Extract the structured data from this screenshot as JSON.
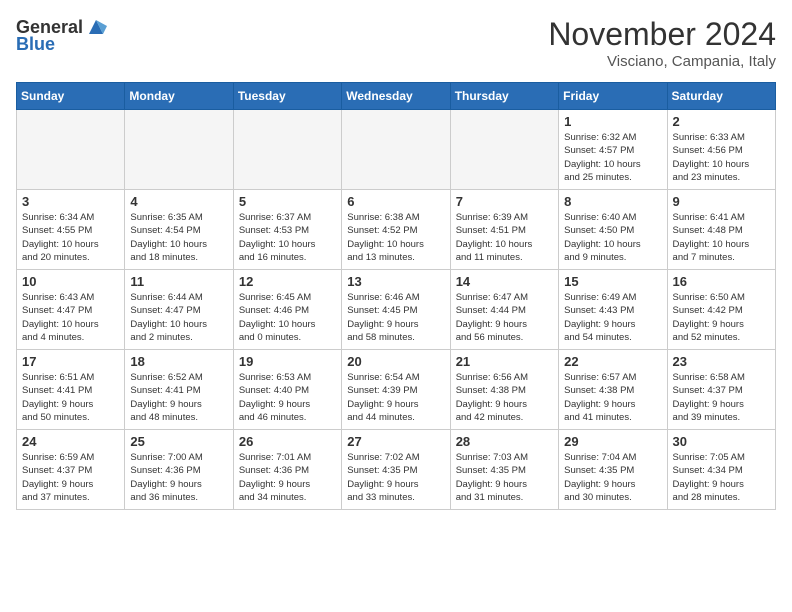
{
  "header": {
    "logo": {
      "general": "General",
      "blue": "Blue"
    },
    "title": "November 2024",
    "location": "Visciano, Campania, Italy"
  },
  "weekdays": [
    "Sunday",
    "Monday",
    "Tuesday",
    "Wednesday",
    "Thursday",
    "Friday",
    "Saturday"
  ],
  "weeks": [
    [
      {
        "day": "",
        "info": "",
        "empty": true
      },
      {
        "day": "",
        "info": "",
        "empty": true
      },
      {
        "day": "",
        "info": "",
        "empty": true
      },
      {
        "day": "",
        "info": "",
        "empty": true
      },
      {
        "day": "",
        "info": "",
        "empty": true
      },
      {
        "day": "1",
        "info": "Sunrise: 6:32 AM\nSunset: 4:57 PM\nDaylight: 10 hours\nand 25 minutes."
      },
      {
        "day": "2",
        "info": "Sunrise: 6:33 AM\nSunset: 4:56 PM\nDaylight: 10 hours\nand 23 minutes."
      }
    ],
    [
      {
        "day": "3",
        "info": "Sunrise: 6:34 AM\nSunset: 4:55 PM\nDaylight: 10 hours\nand 20 minutes."
      },
      {
        "day": "4",
        "info": "Sunrise: 6:35 AM\nSunset: 4:54 PM\nDaylight: 10 hours\nand 18 minutes."
      },
      {
        "day": "5",
        "info": "Sunrise: 6:37 AM\nSunset: 4:53 PM\nDaylight: 10 hours\nand 16 minutes."
      },
      {
        "day": "6",
        "info": "Sunrise: 6:38 AM\nSunset: 4:52 PM\nDaylight: 10 hours\nand 13 minutes."
      },
      {
        "day": "7",
        "info": "Sunrise: 6:39 AM\nSunset: 4:51 PM\nDaylight: 10 hours\nand 11 minutes."
      },
      {
        "day": "8",
        "info": "Sunrise: 6:40 AM\nSunset: 4:50 PM\nDaylight: 10 hours\nand 9 minutes."
      },
      {
        "day": "9",
        "info": "Sunrise: 6:41 AM\nSunset: 4:48 PM\nDaylight: 10 hours\nand 7 minutes."
      }
    ],
    [
      {
        "day": "10",
        "info": "Sunrise: 6:43 AM\nSunset: 4:47 PM\nDaylight: 10 hours\nand 4 minutes."
      },
      {
        "day": "11",
        "info": "Sunrise: 6:44 AM\nSunset: 4:47 PM\nDaylight: 10 hours\nand 2 minutes."
      },
      {
        "day": "12",
        "info": "Sunrise: 6:45 AM\nSunset: 4:46 PM\nDaylight: 10 hours\nand 0 minutes."
      },
      {
        "day": "13",
        "info": "Sunrise: 6:46 AM\nSunset: 4:45 PM\nDaylight: 9 hours\nand 58 minutes."
      },
      {
        "day": "14",
        "info": "Sunrise: 6:47 AM\nSunset: 4:44 PM\nDaylight: 9 hours\nand 56 minutes."
      },
      {
        "day": "15",
        "info": "Sunrise: 6:49 AM\nSunset: 4:43 PM\nDaylight: 9 hours\nand 54 minutes."
      },
      {
        "day": "16",
        "info": "Sunrise: 6:50 AM\nSunset: 4:42 PM\nDaylight: 9 hours\nand 52 minutes."
      }
    ],
    [
      {
        "day": "17",
        "info": "Sunrise: 6:51 AM\nSunset: 4:41 PM\nDaylight: 9 hours\nand 50 minutes."
      },
      {
        "day": "18",
        "info": "Sunrise: 6:52 AM\nSunset: 4:41 PM\nDaylight: 9 hours\nand 48 minutes."
      },
      {
        "day": "19",
        "info": "Sunrise: 6:53 AM\nSunset: 4:40 PM\nDaylight: 9 hours\nand 46 minutes."
      },
      {
        "day": "20",
        "info": "Sunrise: 6:54 AM\nSunset: 4:39 PM\nDaylight: 9 hours\nand 44 minutes."
      },
      {
        "day": "21",
        "info": "Sunrise: 6:56 AM\nSunset: 4:38 PM\nDaylight: 9 hours\nand 42 minutes."
      },
      {
        "day": "22",
        "info": "Sunrise: 6:57 AM\nSunset: 4:38 PM\nDaylight: 9 hours\nand 41 minutes."
      },
      {
        "day": "23",
        "info": "Sunrise: 6:58 AM\nSunset: 4:37 PM\nDaylight: 9 hours\nand 39 minutes."
      }
    ],
    [
      {
        "day": "24",
        "info": "Sunrise: 6:59 AM\nSunset: 4:37 PM\nDaylight: 9 hours\nand 37 minutes."
      },
      {
        "day": "25",
        "info": "Sunrise: 7:00 AM\nSunset: 4:36 PM\nDaylight: 9 hours\nand 36 minutes."
      },
      {
        "day": "26",
        "info": "Sunrise: 7:01 AM\nSunset: 4:36 PM\nDaylight: 9 hours\nand 34 minutes."
      },
      {
        "day": "27",
        "info": "Sunrise: 7:02 AM\nSunset: 4:35 PM\nDaylight: 9 hours\nand 33 minutes."
      },
      {
        "day": "28",
        "info": "Sunrise: 7:03 AM\nSunset: 4:35 PM\nDaylight: 9 hours\nand 31 minutes."
      },
      {
        "day": "29",
        "info": "Sunrise: 7:04 AM\nSunset: 4:35 PM\nDaylight: 9 hours\nand 30 minutes."
      },
      {
        "day": "30",
        "info": "Sunrise: 7:05 AM\nSunset: 4:34 PM\nDaylight: 9 hours\nand 28 minutes."
      }
    ]
  ]
}
